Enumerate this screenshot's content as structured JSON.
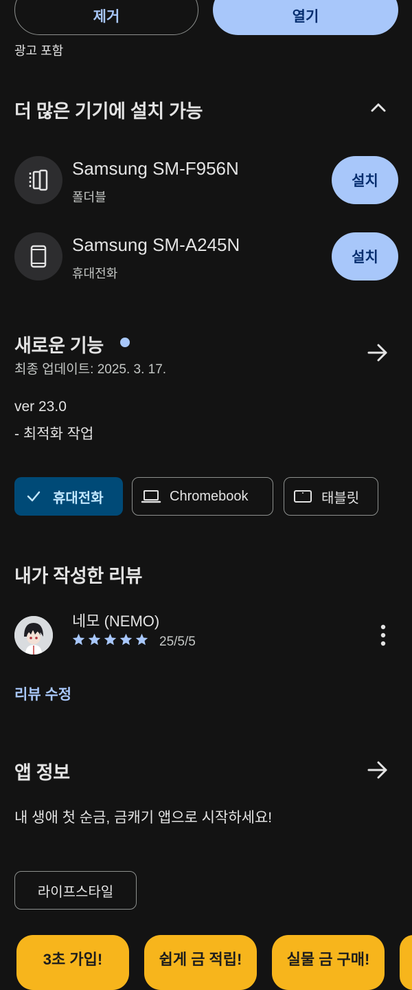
{
  "top_actions": {
    "remove_label": "제거",
    "open_label": "열기",
    "ads_note": "광고 포함"
  },
  "more_devices": {
    "title": "더 많은 기기에 설치 가능",
    "collapse_icon": "chevron-up-icon",
    "devices": [
      {
        "name": "Samsung SM-F956N",
        "type": "폴더블",
        "icon": "foldable-icon",
        "action": "설치"
      },
      {
        "name": "Samsung SM-A245N",
        "type": "휴대전화",
        "icon": "phone-icon",
        "action": "설치"
      }
    ]
  },
  "whats_new": {
    "title": "새로운 기능",
    "updated": "최종 업데이트: 2025. 3. 17.",
    "version": "ver 23.0",
    "notes": "- 최적화 작업",
    "dot_color": "#a8c7fa"
  },
  "device_chips": [
    {
      "label": "휴대전화",
      "icon": "check-icon",
      "selected": true
    },
    {
      "label": "Chromebook",
      "icon": "laptop-icon",
      "selected": false
    },
    {
      "label": "태블릿",
      "icon": "tablet-icon",
      "selected": false
    }
  ],
  "my_review": {
    "title": "내가 작성한 리뷰",
    "author": "네모 (NEMO)",
    "rating": 5,
    "date": "25/5/5",
    "edit_label": "리뷰 수정"
  },
  "app_info": {
    "title": "앱 정보",
    "description": "내 생애 첫 순금, 금캐기 앱으로 시작하세요!",
    "category": "라이프스타일"
  },
  "promo_cards": [
    {
      "label": "3초 가입!"
    },
    {
      "label": "쉽게 금 적립!"
    },
    {
      "label": "실물 금 구매!"
    }
  ],
  "colors": {
    "background": "#131313",
    "accent": "#a8c7fa",
    "selected_chip": "#004a77",
    "promo": "#f7b51c"
  }
}
